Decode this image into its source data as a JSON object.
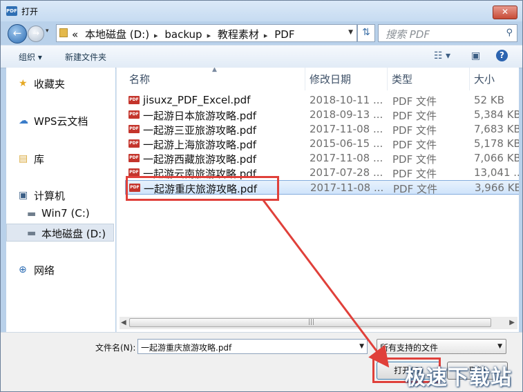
{
  "window": {
    "title": "打开",
    "app_icon_text": "PDF",
    "close_glyph": "✕"
  },
  "address_bar": {
    "crumbs": [
      "«",
      "本地磁盘 (D:)",
      "backup",
      "教程素材",
      "PDF"
    ],
    "search_placeholder": "搜索 PDF"
  },
  "toolbar": {
    "organize": "组织 ▾",
    "new_folder": "新建文件夹"
  },
  "nav": {
    "items": [
      {
        "label": "收藏夹",
        "icon": "star-icon",
        "glyph": "★",
        "color": "#e5a823"
      },
      {
        "label": "WPS云文档",
        "icon": "cloud-icon",
        "glyph": "☁",
        "color": "#3a7cc9"
      },
      {
        "label": "库",
        "icon": "library-icon",
        "glyph": "▤",
        "color": "#d9a93d"
      },
      {
        "label": "计算机",
        "icon": "computer-icon",
        "glyph": "🖳",
        "color": "#3b5f87"
      },
      {
        "label": "Win7 (C:)",
        "icon": "drive-c-icon",
        "glyph": "▬",
        "color": "#6f7d8c"
      },
      {
        "label": "本地磁盘 (D:)",
        "icon": "drive-d-icon",
        "glyph": "▬",
        "color": "#6f7d8c"
      },
      {
        "label": "网络",
        "icon": "network-icon",
        "glyph": "⊕",
        "color": "#2b6bb3"
      }
    ]
  },
  "columns": {
    "name": "名称",
    "date": "修改日期",
    "type": "类型",
    "size": "大小"
  },
  "files": [
    {
      "name": "jisuxz_PDF_Excel.pdf",
      "date": "2018-10-11 ...",
      "type": "PDF 文件",
      "size": "52 KB"
    },
    {
      "name": "一起游日本旅游攻略.pdf",
      "date": "2018-09-13 ...",
      "type": "PDF 文件",
      "size": "5,384 KB"
    },
    {
      "name": "一起游三亚旅游攻略.pdf",
      "date": "2017-11-08 ...",
      "type": "PDF 文件",
      "size": "7,683 KB"
    },
    {
      "name": "一起游上海旅游攻略.pdf",
      "date": "2015-06-15 ...",
      "type": "PDF 文件",
      "size": "5,178 KB"
    },
    {
      "name": "一起游西藏旅游攻略.pdf",
      "date": "2017-11-08 ...",
      "type": "PDF 文件",
      "size": "7,066 KB"
    },
    {
      "name": "一起游云南旅游攻略.pdf",
      "date": "2017-07-28 ...",
      "type": "PDF 文件",
      "size": "13,041 ..."
    },
    {
      "name": "一起游重庆旅游攻略.pdf",
      "date": "2017-11-08 ...",
      "type": "PDF 文件",
      "size": "3,966 KB"
    }
  ],
  "selected_index": 6,
  "bottom": {
    "filename_label": "文件名(N):",
    "filename_value": "一起游重庆旅游攻略.pdf",
    "filter_value": "所有支持的文件",
    "open_button": "打开(O)",
    "cancel_button": "取消"
  },
  "watermark": "极速下载站",
  "colors": {
    "annotation_red": "#e0403a",
    "selection_blue": "#cfe4fb"
  }
}
